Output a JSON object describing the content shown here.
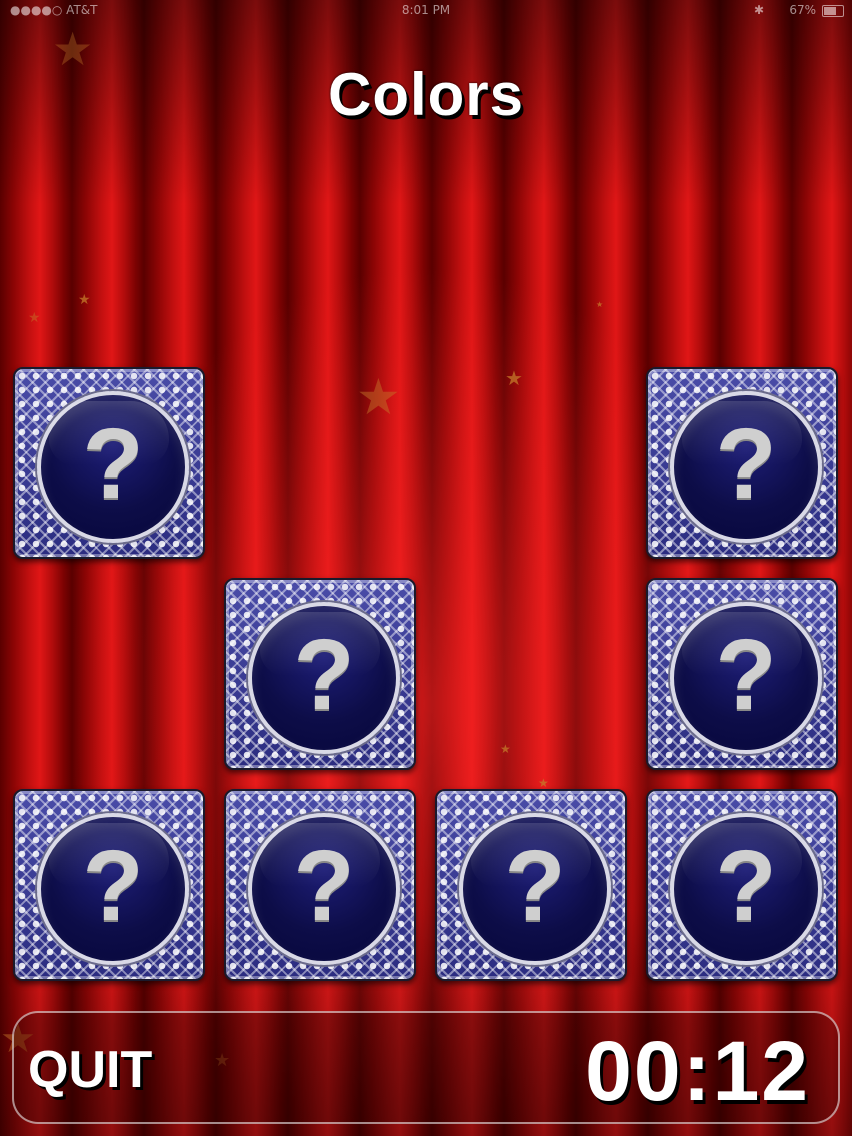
{
  "status_bar": {
    "carrier": "●●●●○ AT&T",
    "time": "8:01 PM",
    "battery": "67%"
  },
  "title": "Colors",
  "cards": [
    {
      "id": "card-1",
      "symbol": "?"
    },
    {
      "id": "card-2",
      "symbol": "?"
    },
    {
      "id": "card-3",
      "symbol": "?"
    },
    {
      "id": "card-4",
      "symbol": "?"
    },
    {
      "id": "card-5",
      "symbol": "?"
    },
    {
      "id": "card-6",
      "symbol": "?"
    },
    {
      "id": "card-7",
      "symbol": "?"
    },
    {
      "id": "card-8",
      "symbol": "?"
    }
  ],
  "footer": {
    "quit_label": "QUIT",
    "timer": "00:12"
  },
  "colors": {
    "curtain": "#c41010",
    "card_back": "#2e2f88",
    "card_circle": "#0d0d48",
    "text": "#ffffff"
  }
}
